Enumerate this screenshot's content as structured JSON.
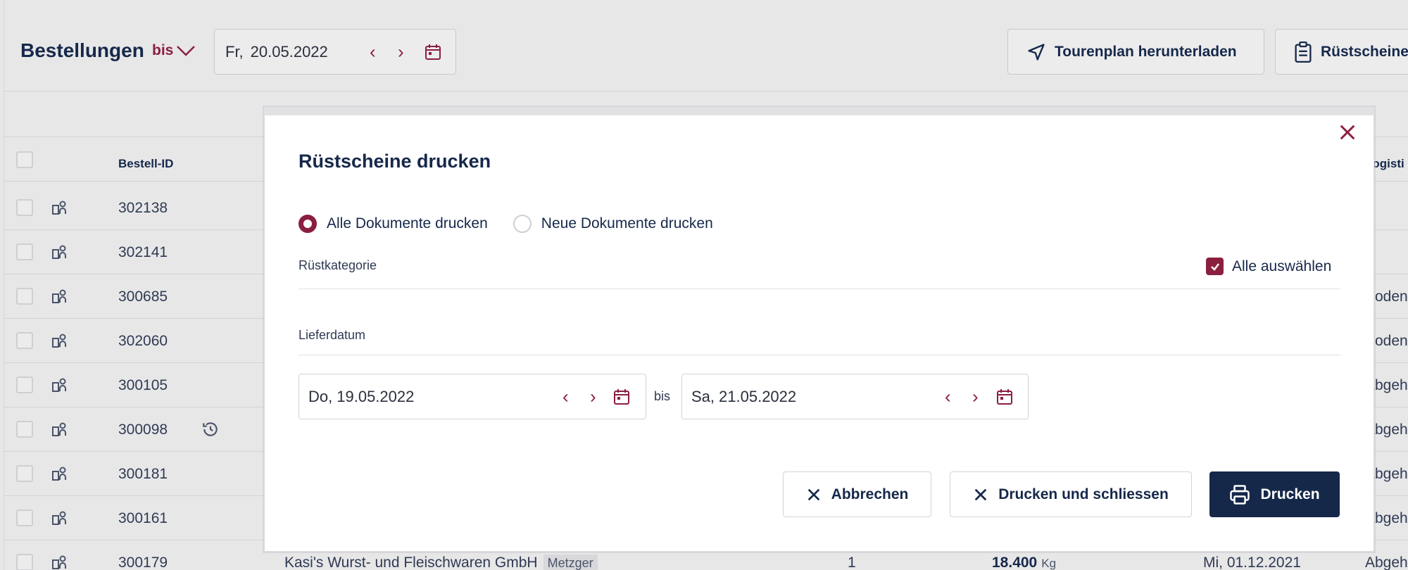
{
  "header": {
    "title": "Bestellungen",
    "range_toggle": "bis",
    "date": {
      "weekday": "Fr,",
      "value": "20.05.2022"
    },
    "buttons": {
      "tourplan": "Tourenplan herunterladen",
      "ruestscheine": "Rüstscheine"
    }
  },
  "table": {
    "columns": {
      "id": "Bestell-ID",
      "logistic": "Logisti"
    },
    "rows": [
      {
        "id": "302138",
        "right": ""
      },
      {
        "id": "302141",
        "right": ""
      },
      {
        "id": "300685",
        "right": "Boden"
      },
      {
        "id": "302060",
        "right": "Boden"
      },
      {
        "id": "300105",
        "right": "Abgeh"
      },
      {
        "id": "300098",
        "right": "Abgeh"
      },
      {
        "id": "300181",
        "right": "Abgeh"
      },
      {
        "id": "300161",
        "right": "Abgeh"
      },
      {
        "id": "300179",
        "right": "Abgeh",
        "customer": "Kasi's Wurst- und Fleischwaren GmbH",
        "tag": "Metzger",
        "qty": "1",
        "weight": "18.400",
        "unit": "Kg",
        "date": "Mi, 01.12.2021"
      }
    ]
  },
  "modal": {
    "title": "Rüstscheine drucken",
    "radio_all": "Alle Dokumente drucken",
    "radio_new": "Neue Dokumente drucken",
    "category_label": "Rüstkategorie",
    "select_all": "Alle auswählen",
    "delivery_label": "Lieferdatum",
    "from_date": {
      "weekday": "Do,",
      "value": "19.05.2022"
    },
    "bis": "bis",
    "to_date": {
      "weekday": "Sa,",
      "value": "21.05.2022"
    },
    "buttons": {
      "cancel": "Abbrechen",
      "print_close": "Drucken und schliessen",
      "print": "Drucken"
    }
  },
  "colors": {
    "accent": "#8b1f3f",
    "navy": "#16284a"
  }
}
